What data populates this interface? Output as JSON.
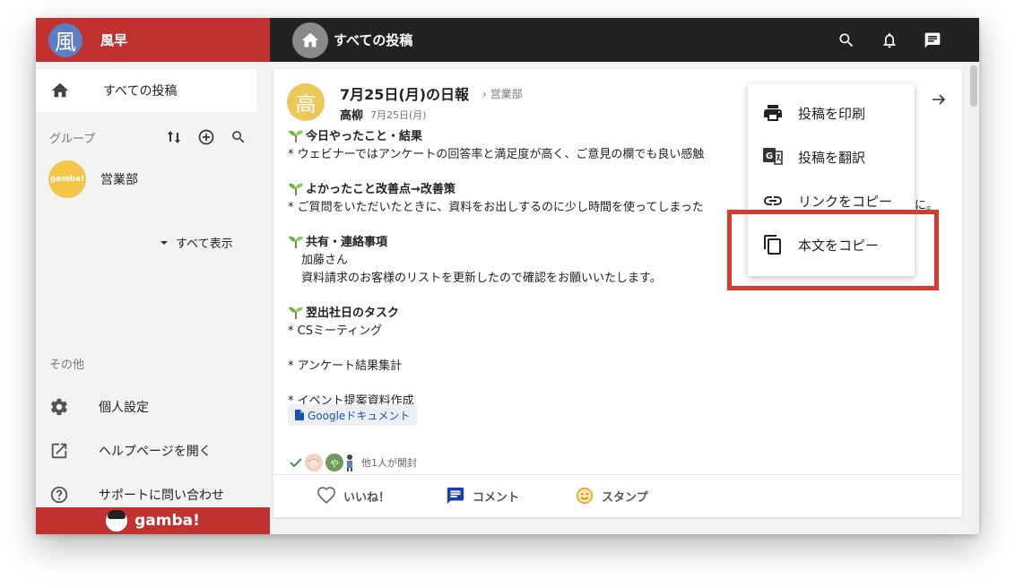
{
  "brand": {
    "logo_char": "風",
    "name": "風早"
  },
  "topbar": {
    "title": "すべての投稿"
  },
  "sidebar": {
    "all_posts_label": "すべての投稿",
    "group_header": "グループ",
    "group": {
      "avatar_text": "gamba!",
      "name": "営業部"
    },
    "show_all_label": "すべて表示",
    "other_header": "その他",
    "items": [
      {
        "label": "個人設定"
      },
      {
        "label": "ヘルプページを開く"
      },
      {
        "label": "サポートに問い合わせ"
      }
    ],
    "footer_logo": "gamba!"
  },
  "post": {
    "avatar_char": "高",
    "title": "7月25日(月)の日報",
    "group": "› 営業部",
    "author": "高柳",
    "date": "7月25日(月)",
    "lines": [
      {
        "text": "今日やったこと・結果",
        "heading": true
      },
      {
        "text": "* ウェビナーではアンケートの回答率と満足度が高く、ご意見の欄でも良い感触"
      },
      {
        "text": "よかったこと改善点→改善策",
        "heading": true
      },
      {
        "text": "* ご質問をいただいたときに、資料をお出しするのに少し時間を使ってしまった"
      },
      {
        "text": "共有・連絡事項",
        "heading": true
      },
      {
        "text": "加藤さん"
      },
      {
        "text": "資料請求のお客様のリストを更新したので確認をお願いいたします。"
      },
      {
        "text": "翌出社日のタスク",
        "heading": true
      },
      {
        "text": "* CSミーティング"
      },
      {
        "text": "* アンケート結果集計"
      },
      {
        "text": "* イベント提案資料作成"
      }
    ],
    "overflow_char": "に。",
    "doc_link": "Googleドキュメント",
    "reader_initial": "や",
    "read_label": "他1人が開封",
    "actions": {
      "like": "いいね！",
      "comment": "コメント",
      "stamp": "スタンプ"
    }
  },
  "menu": {
    "items": [
      {
        "label": "投稿を印刷"
      },
      {
        "label": "投稿を翻訳"
      },
      {
        "label": "リンクをコピー"
      },
      {
        "label": "本文をコピー"
      }
    ]
  },
  "colors": {
    "brand_red": "#c0312f",
    "topbar": "#222222",
    "highlight": "#d83a2b",
    "link": "#1a53b8"
  }
}
